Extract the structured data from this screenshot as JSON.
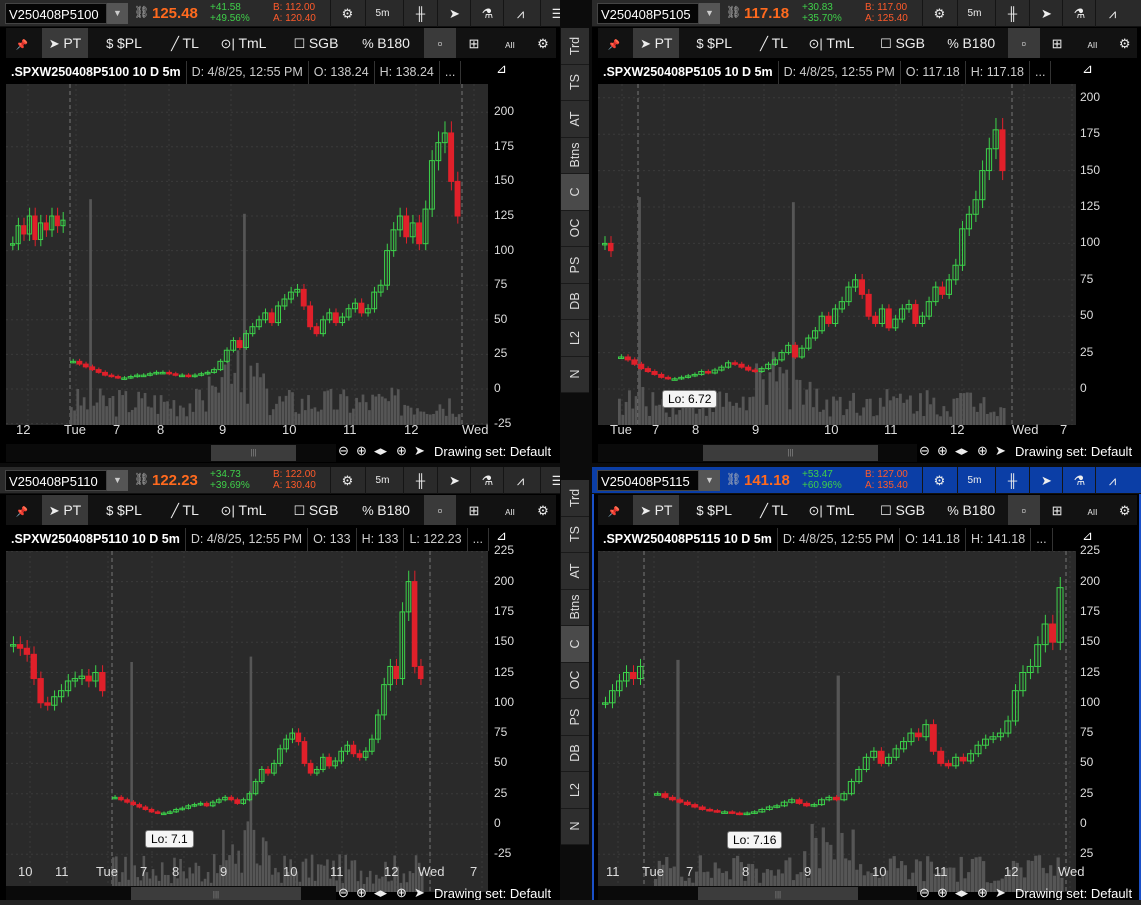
{
  "panels": [
    {
      "symbol": "V250408P5100",
      "last": "125.48",
      "change": "+41.58",
      "change_pct": "+49.56%",
      "bid": "B: 112.00",
      "ask": "A: 120.40",
      "title": ".SPXW250408P5100 10 D 5m",
      "date": "D: 4/8/25, 12:55 PM",
      "open": "O: 138.24",
      "high": "H: 138.24",
      "low": null,
      "more": "...",
      "y_labels": [
        "200",
        "175",
        "150",
        "125",
        "100",
        "75",
        "50",
        "25",
        "0",
        "-25"
      ],
      "time_labels": [
        "12",
        "Tue",
        "7",
        "8",
        "9",
        "10",
        "11",
        "12",
        "Wed"
      ],
      "lo_label": null,
      "prev_closes": [
        105,
        118,
        112,
        125,
        108,
        120,
        115,
        125,
        118,
        122
      ],
      "closes": [
        20,
        18,
        16,
        14,
        12,
        10,
        9,
        8,
        8,
        9,
        10,
        10,
        11,
        12,
        12,
        11,
        10,
        10,
        9,
        10,
        11,
        12,
        14,
        20,
        28,
        35,
        30,
        40,
        45,
        50,
        55,
        48,
        60,
        65,
        70,
        72,
        60,
        45,
        40,
        50,
        55,
        48,
        52,
        58,
        62,
        55,
        58,
        70,
        75,
        100,
        115,
        125,
        110,
        120,
        105,
        130,
        165,
        178,
        185,
        150,
        125
      ]
    },
    {
      "symbol": "V250408P5105",
      "last": "117.18",
      "change": "+30.83",
      "change_pct": "+35.70%",
      "bid": "B: 117.00",
      "ask": "A: 125.40",
      "title": ".SPXW250408P5105 10 D 5m",
      "date": "D: 4/8/25, 12:55 PM",
      "open": "O: 117.18",
      "high": "H: 117.18",
      "low": null,
      "more": "...",
      "y_labels": [
        "200",
        "175",
        "150",
        "125",
        "100",
        "75",
        "50",
        "25",
        "0"
      ],
      "time_labels": [
        "Tue",
        "7",
        "8",
        "9",
        "10",
        "11",
        "12",
        "Wed",
        "7"
      ],
      "lo_label": "Lo: 6.72",
      "prev_closes": [
        100,
        95
      ],
      "closes": [
        22,
        20,
        17,
        14,
        12,
        10,
        8,
        7,
        7,
        8,
        9,
        10,
        12,
        11,
        13,
        15,
        18,
        17,
        15,
        13,
        12,
        14,
        17,
        20,
        25,
        30,
        22,
        28,
        35,
        40,
        50,
        45,
        55,
        60,
        70,
        75,
        65,
        50,
        45,
        55,
        42,
        48,
        55,
        58,
        45,
        50,
        60,
        70,
        65,
        75,
        85,
        110,
        120,
        130,
        150,
        165,
        178,
        150
      ]
    },
    {
      "symbol": "V250408P5110",
      "last": "122.23",
      "change": "+34.73",
      "change_pct": "+39.69%",
      "bid": "B: 122.00",
      "ask": "A: 130.40",
      "title": ".SPXW250408P5110 10 D 5m",
      "date": "D: 4/8/25, 12:55 PM",
      "open": "O: 133",
      "high": "H: 133",
      "low": "L: 122.23",
      "more": "...",
      "y_labels": [
        "225",
        "200",
        "175",
        "150",
        "125",
        "100",
        "75",
        "50",
        "25",
        "0",
        "-25"
      ],
      "time_labels": [
        "10",
        "11",
        "Tue",
        "7",
        "8",
        "9",
        "10",
        "11",
        "12",
        "Wed",
        "7"
      ],
      "lo_label": "Lo: 7.1",
      "prev_closes": [
        148,
        145,
        140,
        120,
        100,
        98,
        105,
        110,
        118,
        120,
        122,
        118,
        125,
        110
      ],
      "closes": [
        22,
        20,
        18,
        16,
        14,
        12,
        10,
        9,
        9,
        10,
        12,
        13,
        15,
        16,
        17,
        15,
        18,
        20,
        22,
        20,
        17,
        20,
        25,
        35,
        45,
        42,
        50,
        62,
        70,
        75,
        68,
        50,
        42,
        45,
        55,
        48,
        52,
        60,
        65,
        58,
        55,
        60,
        70,
        90,
        115,
        130,
        120,
        175,
        200,
        130,
        120
      ]
    },
    {
      "symbol": "V250408P5115",
      "last": "141.18",
      "change": "+53.47",
      "change_pct": "+60.96%",
      "bid": "B: 127.00",
      "ask": "A: 135.40",
      "title": ".SPXW250408P5115 10 D 5m",
      "date": "D: 4/8/25, 12:55 PM",
      "open": "O: 141.18",
      "high": "H: 141.18",
      "low": null,
      "more": "...",
      "y_labels": [
        "225",
        "200",
        "175",
        "150",
        "125",
        "100",
        "75",
        "50",
        "25",
        "0",
        "25"
      ],
      "time_labels": [
        "11",
        "Tue",
        "7",
        "8",
        "9",
        "10",
        "11",
        "12",
        "Wed"
      ],
      "lo_label": "Lo: 7.16",
      "prev_closes": [
        100,
        110,
        118,
        125,
        120,
        130
      ],
      "closes": [
        25,
        22,
        20,
        18,
        16,
        14,
        12,
        11,
        10,
        10,
        9,
        8,
        9,
        10,
        12,
        14,
        15,
        18,
        20,
        17,
        15,
        16,
        20,
        22,
        20,
        25,
        35,
        45,
        55,
        60,
        50,
        55,
        62,
        68,
        75,
        72,
        82,
        60,
        50,
        48,
        55,
        52,
        58,
        65,
        70,
        72,
        75,
        85,
        110,
        125,
        130,
        148,
        165,
        150,
        195
      ]
    }
  ],
  "header_buttons": {
    "interval": "5m"
  },
  "toolbar": {
    "pt": "PT",
    "pl": "$PL",
    "tl": "TL",
    "tml": "TmL",
    "sgb": "SGB",
    "b180": "B180",
    "all": "AII"
  },
  "footer": {
    "drawing_set": "Drawing set: Default"
  },
  "side_tabs": [
    "Trd",
    "TS",
    "AT",
    "Btns",
    "C",
    "OC",
    "PS",
    "DB",
    "L2",
    "N"
  ],
  "colors": {
    "up": "#3cd24a",
    "down": "#e0202a",
    "last": "#ff6a1e",
    "header_active": "#0b3ea6"
  }
}
